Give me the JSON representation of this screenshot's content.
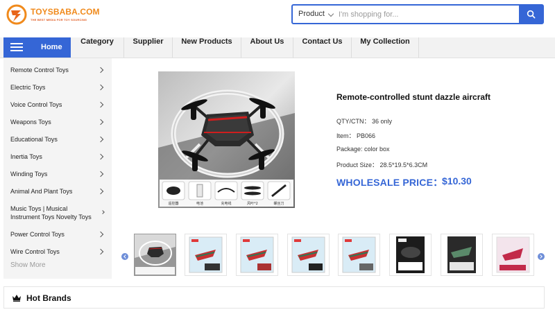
{
  "header": {
    "logo": {
      "name": "TOYSBABA.COM",
      "tagline": "THE BEST MEDIA FOR TOY SOURCING"
    },
    "search": {
      "category": "Product",
      "placeholder": "I'm shopping for...",
      "value": ""
    }
  },
  "nav": {
    "home": "Home",
    "items": [
      "Category",
      "Supplier",
      "New Products",
      "About Us",
      "Contact Us",
      "My Collection"
    ]
  },
  "sidebar": {
    "items": [
      {
        "label": "Remote Control Toys"
      },
      {
        "label": "Electric Toys"
      },
      {
        "label": "Voice Control Toys"
      },
      {
        "label": "Weapons Toys"
      },
      {
        "label": "Educational Toys"
      },
      {
        "label": "Inertia Toys"
      },
      {
        "label": "Winding Toys"
      },
      {
        "label": "Animal And Plant Toys"
      },
      {
        "label": "Music Toys | Musical Instrument Toys Novelty Toys"
      },
      {
        "label": "Power Control Toys"
      },
      {
        "label": "Wire Control Toys"
      }
    ],
    "show_more": "Show More"
  },
  "product": {
    "title": "Remote-controlled stunt dazzle aircraft",
    "qty": "QTY/CTN：  36 only",
    "item": "Item：  PB066",
    "package": "Package:  color box",
    "size": "Product Size：  28.5*19.5*6.3CM",
    "price_label": "WHOLESALE PRICE：",
    "price_value": "$10.30",
    "image_captions": [
      "遥控器",
      "电池",
      "充电线",
      "风叶*2",
      "螺丝刀"
    ],
    "thumbnail_count": 8
  },
  "hot_brands": {
    "label": "Hot Brands"
  },
  "colors": {
    "accent": "#3566d6",
    "logo_orange": "#f08a1c"
  }
}
